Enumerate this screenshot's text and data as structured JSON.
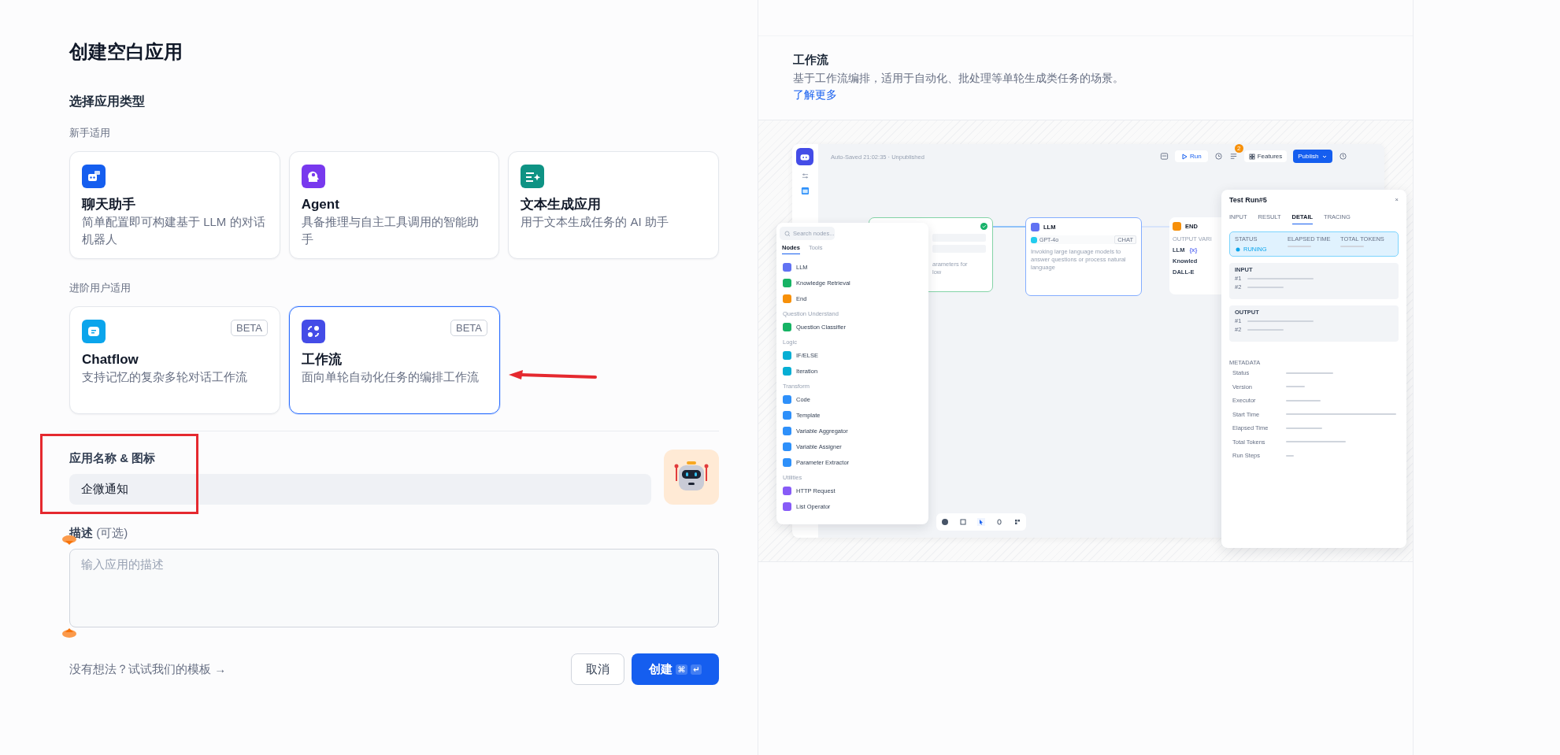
{
  "title": "创建空白应用",
  "type_section": {
    "title": "选择应用类型",
    "groups": [
      {
        "label": "新手适用",
        "cards": [
          {
            "kind": "chat",
            "title": "聊天助手",
            "description": "简单配置即可构建基于 LLM 的对话机器人",
            "selected": false
          },
          {
            "kind": "agent",
            "title": "Agent",
            "description": "具备推理与自主工具调用的智能助手",
            "selected": false
          },
          {
            "kind": "text",
            "title": "文本生成应用",
            "description": "用于文本生成任务的 AI 助手",
            "selected": false
          }
        ]
      },
      {
        "label": "进阶用户适用",
        "cards": [
          {
            "kind": "chatflow",
            "title": "Chatflow",
            "description": "支持记忆的复杂多轮对话工作流",
            "badge": "BETA",
            "selected": false
          },
          {
            "kind": "workflow",
            "title": "工作流",
            "description": "面向单轮自动化任务的编排工作流",
            "badge": "BETA",
            "selected": true
          }
        ]
      }
    ]
  },
  "name_field": {
    "label": "应用名称 & 图标",
    "value": "企微通知"
  },
  "description_field": {
    "label": "描述",
    "optional": "(可选)",
    "placeholder": "输入应用的描述"
  },
  "footer": {
    "template_link": "没有想法？试试我们的模板",
    "arrow": "→",
    "cancel": "取消",
    "create": "创建",
    "shortcut": [
      "⌘",
      "↵"
    ]
  },
  "info": {
    "title": "工作流",
    "description": "基于工作流编排，适用于自动化、批处理等单轮生成类任务的场景。",
    "link": "了解更多"
  },
  "preview": {
    "autosave": "Auto-Saved 21:02:35 · Unpublished",
    "toolbar": {
      "run": "Run",
      "badge": "2",
      "features": "Features",
      "publish": "Publish"
    },
    "nodes_panel": {
      "search_placeholder": "Search nodes...",
      "tabs": [
        {
          "label": "Nodes",
          "selected": true
        },
        {
          "label": "Tools",
          "selected": false
        }
      ],
      "items": [
        {
          "kind": "node",
          "label": "LLM",
          "color": "#6172f3"
        },
        {
          "kind": "node",
          "label": "Knowledge Retrieval",
          "color": "#16b364"
        },
        {
          "kind": "node",
          "label": "End",
          "color": "#f79009"
        },
        {
          "kind": "header",
          "label": "Question Understand"
        },
        {
          "kind": "node",
          "label": "Question Classifier",
          "color": "#16b364"
        },
        {
          "kind": "header",
          "label": "Logic"
        },
        {
          "kind": "node",
          "label": "IF/ELSE",
          "color": "#06aed4"
        },
        {
          "kind": "node",
          "label": "Iteration",
          "color": "#06aed4"
        },
        {
          "kind": "header",
          "label": "Transform"
        },
        {
          "kind": "node",
          "label": "Code",
          "color": "#2e90fa"
        },
        {
          "kind": "node",
          "label": "Template",
          "color": "#2e90fa"
        },
        {
          "kind": "node",
          "label": "Variable Aggregator",
          "color": "#2e90fa"
        },
        {
          "kind": "node",
          "label": "Variable Assigner",
          "color": "#2e90fa"
        },
        {
          "kind": "node",
          "label": "Parameter Extractor",
          "color": "#2e90fa"
        },
        {
          "kind": "header",
          "label": "Utilities"
        },
        {
          "kind": "node",
          "label": "HTTP Request",
          "color": "#875bf7"
        },
        {
          "kind": "node",
          "label": "List Operator",
          "color": "#875bf7"
        }
      ]
    },
    "start_node": {
      "description_lines": [
        "arameters for",
        "low"
      ]
    },
    "llm_node": {
      "title": "LLM",
      "model": "GPT-4o",
      "mode": "CHAT",
      "description": "Invoking large language models to answer questions or process natural language"
    },
    "end_node": {
      "title": "END",
      "output_label": "OUTPUT VARI",
      "outputs": [
        "LLM",
        "Knowled",
        "DALL-E"
      ],
      "variable_tag": "{x}"
    },
    "test_run": {
      "title": "Test Run#5",
      "close": "×",
      "tabs": [
        {
          "label": "INPUT",
          "selected": false
        },
        {
          "label": "RESULT",
          "selected": false
        },
        {
          "label": "DETAIL",
          "selected": true
        },
        {
          "label": "TRACING",
          "selected": false
        }
      ],
      "status": {
        "label": "STATUS",
        "value": "RUNING",
        "elapsed_label": "ELAPSED TIME",
        "tokens_label": "TOTAL TOKENS"
      },
      "sections": [
        {
          "title": "INPUT",
          "rows": [
            "#1",
            "#2"
          ]
        },
        {
          "title": "OUTPUT",
          "rows": [
            "#1",
            "#2"
          ]
        }
      ],
      "metadata_title": "METADATA",
      "metadata": [
        "Status",
        "Version",
        "Executor",
        "Start Time",
        "Elapsed Time",
        "Total Tokens",
        "Run Steps"
      ]
    }
  }
}
